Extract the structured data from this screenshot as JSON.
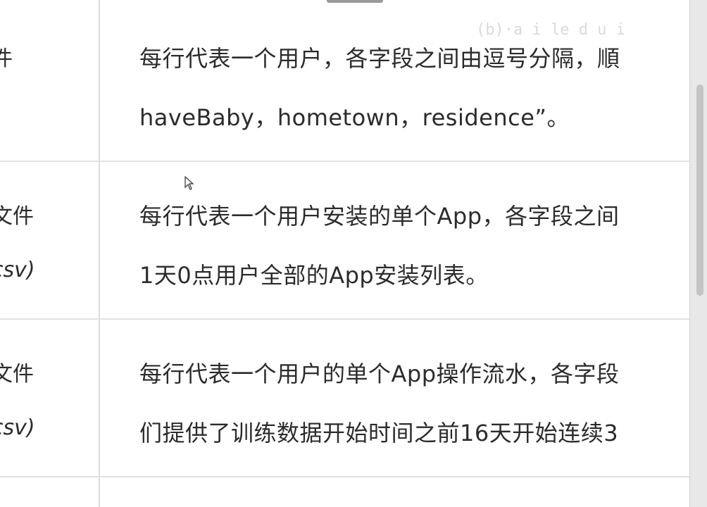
{
  "watermark": "(b)·a i le d u i",
  "rows": [
    {
      "left_lines": [
        "件"
      ],
      "lines": [
        "每行代表一个用户，各字段之间由逗号分隔，順",
        "haveBaby，hometown，residence”。"
      ]
    },
    {
      "left_lines": [
        "文件",
        "csv)"
      ],
      "lines": [
        "每行代表一个用户安装的单个App，各字段之间",
        "1天0点用户全部的App安装列表。"
      ]
    },
    {
      "left_lines": [
        "文件",
        "csv)"
      ],
      "lines": [
        "每行代表一个用户的单个App操作流水，各字段",
        "们提供了训练数据开始时间之前16天开始连续3"
      ]
    }
  ]
}
